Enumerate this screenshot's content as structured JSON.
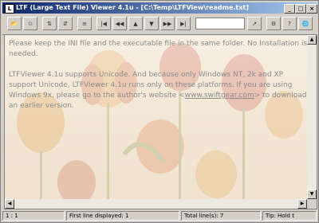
{
  "window": {
    "title": "LTF (Large Text File) Viewer 4.1u - [C:\\Temp\\LTFView\\readme.txt]"
  },
  "toolbar": {
    "buttons": [
      {
        "icon": "open-folder-icon",
        "glyph": "📂"
      },
      {
        "icon": "copy-icon",
        "glyph": "⧉"
      },
      {
        "icon": "split-icon",
        "glyph": "⇅"
      },
      {
        "icon": "merge-icon",
        "glyph": "⇵"
      },
      {
        "icon": "first-icon",
        "glyph": "|◀"
      },
      {
        "icon": "page-up-icon",
        "glyph": "◀◀"
      },
      {
        "icon": "line-up-icon",
        "glyph": "▲"
      },
      {
        "icon": "line-down-icon",
        "glyph": "▼"
      },
      {
        "icon": "page-down-icon",
        "glyph": "▶▶"
      },
      {
        "icon": "last-icon",
        "glyph": "▶|"
      },
      {
        "icon": "find-icon",
        "glyph": "↗"
      },
      {
        "icon": "settings-icon",
        "glyph": "⚙"
      },
      {
        "icon": "help-icon",
        "glyph": "?"
      },
      {
        "icon": "web-icon",
        "glyph": "🌐"
      }
    ],
    "search_value": ""
  },
  "content": {
    "paragraph1": "Please keep the INI file and the executable file in the same folder. No Installation is needed.",
    "paragraph2_pre": "LTFViewer 4.1u supports Unicode. And because only Windows NT, 2k and XP support Unicode, LTFViewer 4.1u runs only on these platforms. If you are using Windows 9x, please go to the author's website <",
    "link": "www.swiftgear.com",
    "paragraph2_post": "> to download an earlier version."
  },
  "status": {
    "position": "1 : 1",
    "first_line": "First line displayed: 1",
    "total_lines": "Total line(s): 7",
    "tip": "Tip: Hold t"
  },
  "colors": {
    "titlebar_start": "#0a246a",
    "titlebar_end": "#a6caf0",
    "text": "#8b8b8b"
  }
}
